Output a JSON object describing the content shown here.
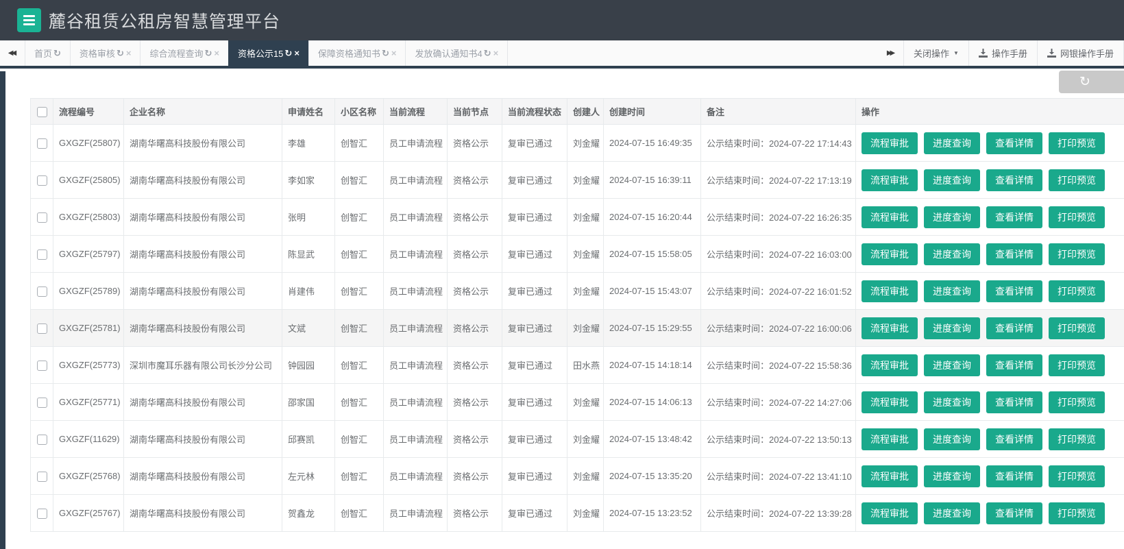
{
  "header": {
    "title": "麓谷租赁公租房智慧管理平台"
  },
  "icons": {
    "refresh": "↻",
    "close": "×",
    "caret_down": "▼",
    "scroll_left": "◀◀",
    "scroll_right": "▶▶"
  },
  "colors": {
    "header_bg": "#394049",
    "brand_teal": "#1ab394",
    "active_tab_bg": "#2f4050",
    "action_button_green": "#1aa98c",
    "table_border": "#e7eaec"
  },
  "tabbar": {
    "tabs": [
      {
        "label": "首页",
        "closable": false,
        "active": false
      },
      {
        "label": "资格审核",
        "closable": true,
        "active": false
      },
      {
        "label": "综合流程查询",
        "closable": true,
        "active": false
      },
      {
        "label": "资格公示15",
        "closable": true,
        "active": true
      },
      {
        "label": "保障资格通知书",
        "closable": true,
        "active": false
      },
      {
        "label": "发放确认通知书4",
        "closable": true,
        "active": false
      }
    ],
    "close_operations_label": "关闭操作",
    "manual_label": "操作手册",
    "bank_manual_label": "网银操作手册"
  },
  "table": {
    "columns": [
      "流程编号",
      "企业名称",
      "申请姓名",
      "小区名称",
      "当前流程",
      "当前节点",
      "当前流程状态",
      "创建人",
      "创建时间",
      "备注",
      "操作"
    ],
    "action_labels": [
      "流程审批",
      "进度查询",
      "查看详情",
      "打印预览"
    ],
    "rows": [
      {
        "id": "GXGZF(25807)",
        "company": "湖南华曙高科技股份有限公司",
        "name": "李雄",
        "community": "创智汇",
        "process": "员工申请流程",
        "node": "资格公示",
        "status": "复审已通过",
        "creator": "刘金耀",
        "created": "2024-07-15 16:49:35",
        "remark": "公示结束时间：2024-07-22 17:14:43",
        "highlighted": false
      },
      {
        "id": "GXGZF(25805)",
        "company": "湖南华曙高科技股份有限公司",
        "name": "李如家",
        "community": "创智汇",
        "process": "员工申请流程",
        "node": "资格公示",
        "status": "复审已通过",
        "creator": "刘金耀",
        "created": "2024-07-15 16:39:11",
        "remark": "公示结束时间：2024-07-22 17:13:19",
        "highlighted": false
      },
      {
        "id": "GXGZF(25803)",
        "company": "湖南华曙高科技股份有限公司",
        "name": "张明",
        "community": "创智汇",
        "process": "员工申请流程",
        "node": "资格公示",
        "status": "复审已通过",
        "creator": "刘金耀",
        "created": "2024-07-15 16:20:44",
        "remark": "公示结束时间：2024-07-22 16:26:35",
        "highlighted": false
      },
      {
        "id": "GXGZF(25797)",
        "company": "湖南华曙高科技股份有限公司",
        "name": "陈显武",
        "community": "创智汇",
        "process": "员工申请流程",
        "node": "资格公示",
        "status": "复审已通过",
        "creator": "刘金耀",
        "created": "2024-07-15 15:58:05",
        "remark": "公示结束时间：2024-07-22 16:03:00",
        "highlighted": false
      },
      {
        "id": "GXGZF(25789)",
        "company": "湖南华曙高科技股份有限公司",
        "name": "肖建伟",
        "community": "创智汇",
        "process": "员工申请流程",
        "node": "资格公示",
        "status": "复审已通过",
        "creator": "刘金耀",
        "created": "2024-07-15 15:43:07",
        "remark": "公示结束时间：2024-07-22 16:01:52",
        "highlighted": false
      },
      {
        "id": "GXGZF(25781)",
        "company": "湖南华曙高科技股份有限公司",
        "name": "文斌",
        "community": "创智汇",
        "process": "员工申请流程",
        "node": "资格公示",
        "status": "复审已通过",
        "creator": "刘金耀",
        "created": "2024-07-15 15:29:55",
        "remark": "公示结束时间：2024-07-22 16:00:06",
        "highlighted": true
      },
      {
        "id": "GXGZF(25773)",
        "company": "深圳市魔耳乐器有限公司长沙分公司",
        "name": "钟园园",
        "community": "创智汇",
        "process": "员工申请流程",
        "node": "资格公示",
        "status": "复审已通过",
        "creator": "田水燕",
        "created": "2024-07-15 14:18:14",
        "remark": "公示结束时间：2024-07-22 15:58:36",
        "highlighted": false
      },
      {
        "id": "GXGZF(25771)",
        "company": "湖南华曙高科技股份有限公司",
        "name": "邵家国",
        "community": "创智汇",
        "process": "员工申请流程",
        "node": "资格公示",
        "status": "复审已通过",
        "creator": "刘金耀",
        "created": "2024-07-15 14:06:13",
        "remark": "公示结束时间：2024-07-22 14:27:06",
        "highlighted": false
      },
      {
        "id": "GXGZF(11629)",
        "company": "湖南华曙高科技股份有限公司",
        "name": "邱赛凯",
        "community": "创智汇",
        "process": "员工申请流程",
        "node": "资格公示",
        "status": "复审已通过",
        "creator": "刘金耀",
        "created": "2024-07-15 13:48:42",
        "remark": "公示结束时间：2024-07-22 13:50:13",
        "highlighted": false
      },
      {
        "id": "GXGZF(25768)",
        "company": "湖南华曙高科技股份有限公司",
        "name": "左元林",
        "community": "创智汇",
        "process": "员工申请流程",
        "node": "资格公示",
        "status": "复审已通过",
        "creator": "刘金耀",
        "created": "2024-07-15 13:35:20",
        "remark": "公示结束时间：2024-07-22 13:41:10",
        "highlighted": false
      },
      {
        "id": "GXGZF(25767)",
        "company": "湖南华曙高科技股份有限公司",
        "name": "贺鑫龙",
        "community": "创智汇",
        "process": "员工申请流程",
        "node": "资格公示",
        "status": "复审已通过",
        "creator": "刘金耀",
        "created": "2024-07-15 13:23:52",
        "remark": "公示结束时间：2024-07-22 13:39:28",
        "highlighted": false
      }
    ]
  }
}
